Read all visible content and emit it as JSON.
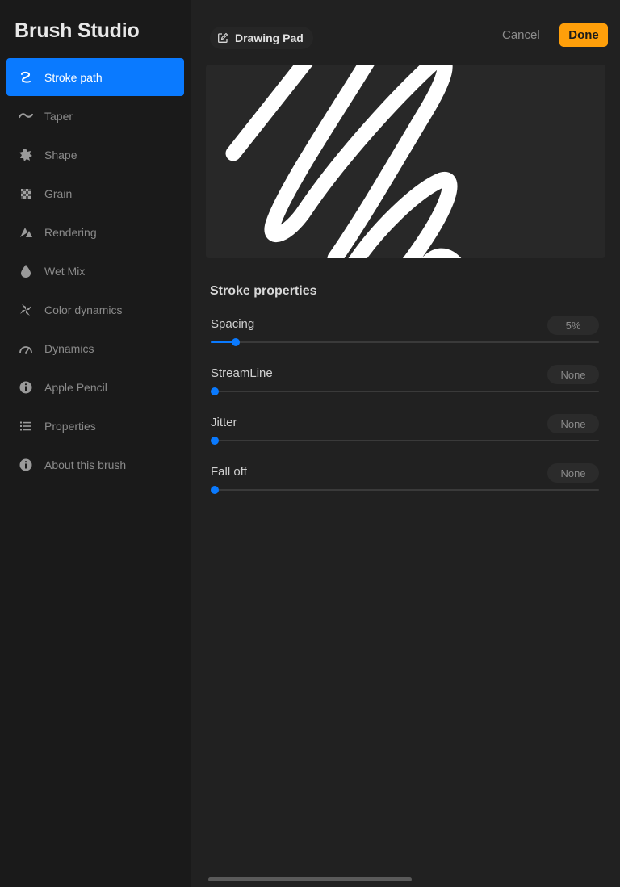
{
  "sidebar": {
    "title": "Brush Studio",
    "items": [
      {
        "label": "Stroke path",
        "icon": "stroke-path-icon",
        "active": true
      },
      {
        "label": "Taper",
        "icon": "taper-icon",
        "active": false
      },
      {
        "label": "Shape",
        "icon": "shape-icon",
        "active": false
      },
      {
        "label": "Grain",
        "icon": "grain-icon",
        "active": false
      },
      {
        "label": "Rendering",
        "icon": "rendering-icon",
        "active": false
      },
      {
        "label": "Wet Mix",
        "icon": "wet-mix-icon",
        "active": false
      },
      {
        "label": "Color dynamics",
        "icon": "color-dynamics-icon",
        "active": false
      },
      {
        "label": "Dynamics",
        "icon": "dynamics-icon",
        "active": false
      },
      {
        "label": "Apple Pencil",
        "icon": "apple-pencil-icon",
        "active": false
      },
      {
        "label": "Properties",
        "icon": "properties-icon",
        "active": false
      },
      {
        "label": "About this brush",
        "icon": "info-icon",
        "active": false
      }
    ]
  },
  "header": {
    "drawing_pad_label": "Drawing Pad",
    "cancel_label": "Cancel",
    "done_label": "Done"
  },
  "stroke_properties": {
    "title": "Stroke properties",
    "sliders": [
      {
        "label": "Spacing",
        "value": "5%",
        "level": 0.055
      },
      {
        "label": "StreamLine",
        "value": "None",
        "level": 0
      },
      {
        "label": "Jitter",
        "value": "None",
        "level": 0
      },
      {
        "label": "Fall off",
        "value": "None",
        "level": 0
      }
    ]
  },
  "colors": {
    "accent": "#0a7aff",
    "done": "#ff9f0a",
    "background": "#212121",
    "sidebar": "#1a1a1a"
  }
}
